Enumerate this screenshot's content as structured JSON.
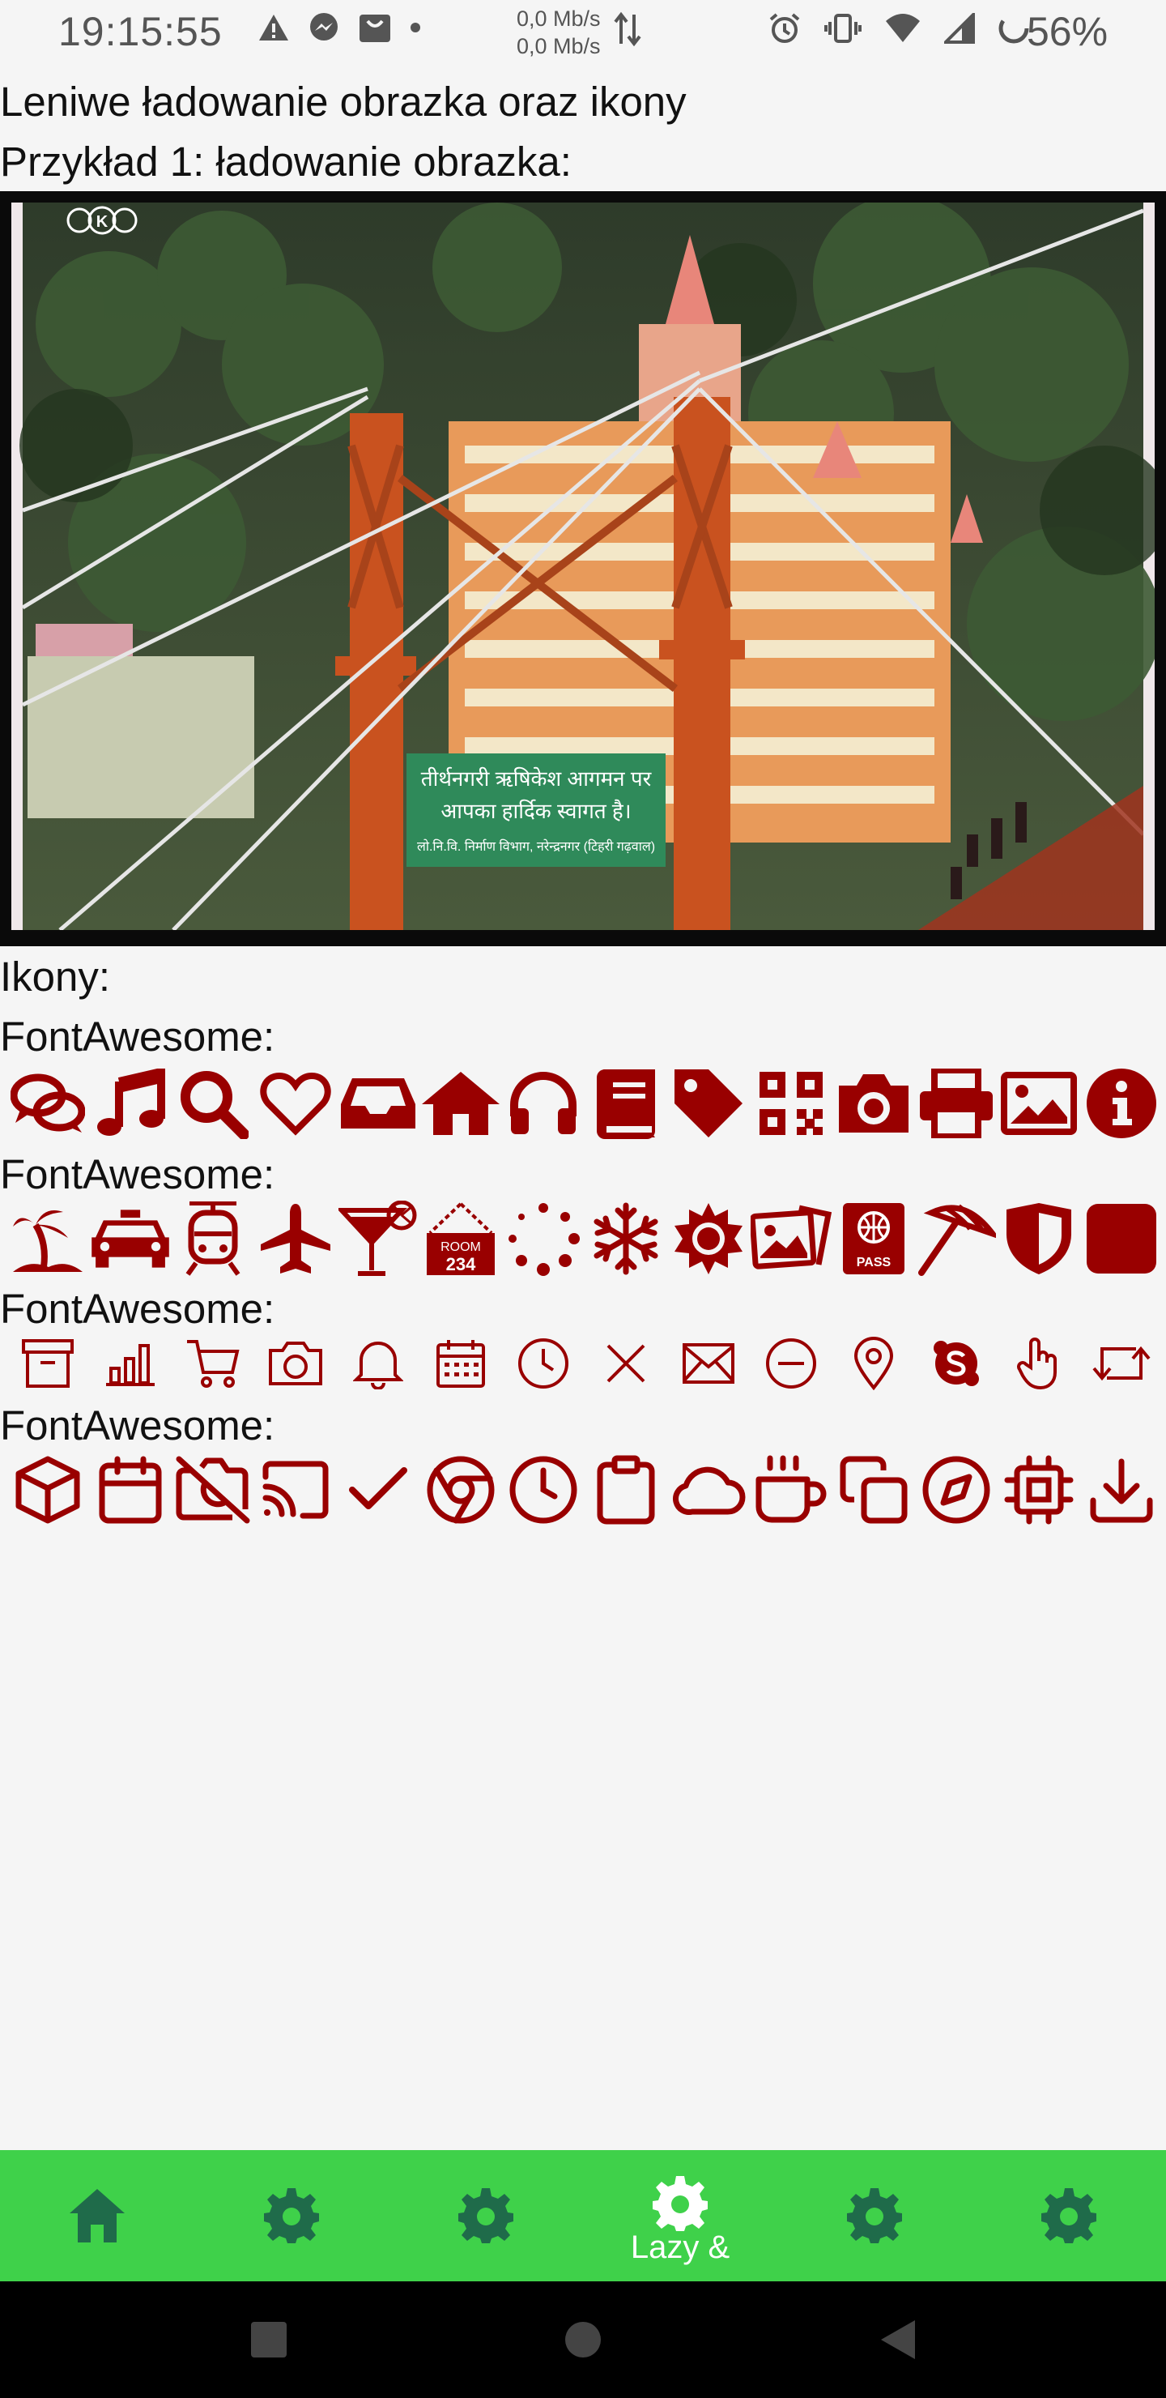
{
  "status_bar": {
    "time": "19:15:55",
    "net_up": "0,0 Mb/s",
    "net_down": "0,0 Mb/s",
    "battery": "56%",
    "icons_left": [
      "warning-icon",
      "messenger-icon",
      "shop-icon",
      "dot-icon"
    ],
    "icons_right": [
      "alarm-icon",
      "vibrate-icon",
      "wifi-icon",
      "signal-icon",
      "battery-icon"
    ]
  },
  "page": {
    "title": "Leniwe ładowanie obrazka oraz ikony",
    "example1": "Przykład 1: ładowanie obrazka:",
    "icons_heading": "Ikony:"
  },
  "image": {
    "watermark": "K",
    "sign_line1": "तीर्थनगरी ऋषिकेश आगमन पर",
    "sign_line2": "आपका हार्दिक स्वागत है।",
    "sign_line3": "लो.नि.वि. निर्माण विभाग, नरेन्द्रनगर (टिहरी गढ़वाल)"
  },
  "icon_sections": [
    {
      "label": "FontAwesome:",
      "icons": [
        "comments-icon",
        "music-icon",
        "search-icon",
        "heart-icon",
        "inbox-icon",
        "home-icon",
        "headphones-icon",
        "book-icon",
        "tag-icon",
        "qrcode-icon",
        "camera-icon",
        "print-icon",
        "image-icon",
        "info-circle-icon"
      ]
    },
    {
      "label": "FontAwesome:",
      "icons": [
        "island-icon",
        "taxi-icon",
        "monorail-icon",
        "plane-icon",
        "cocktail-icon",
        "room-sign-icon",
        "spinner-dots-icon",
        "snowflake-icon",
        "sun-icon",
        "images-icon",
        "passport-icon",
        "umbrella-beach-icon",
        "shield-icon",
        "square-icon"
      ],
      "room_text": "ROOM",
      "room_number": "234",
      "pass_text": "PASS"
    },
    {
      "label": "FontAwesome:",
      "icons": [
        "archive-icon",
        "bar-chart-icon",
        "cart-icon",
        "camera-outline-icon",
        "bell-icon",
        "calendar-icon",
        "clock-icon",
        "close-icon",
        "envelope-icon",
        "minus-circle-icon",
        "map-pin-icon",
        "skype-icon",
        "hand-pointer-icon",
        "retweet-icon"
      ]
    },
    {
      "label": "FontAwesome:",
      "icons": [
        "cube-icon",
        "calendar-outline-icon",
        "camera-off-icon",
        "cast-icon",
        "check-icon",
        "chrome-icon",
        "clock-outline-icon",
        "clipboard-icon",
        "cloud-icon",
        "coffee-icon",
        "copy-icon",
        "compass-icon",
        "cpu-icon",
        "download-icon"
      ]
    }
  ],
  "colors": {
    "icon": "#990000",
    "nav_bg": "#3fd14a",
    "nav_icon": "#1f6b4a",
    "nav_active": "#ffffff"
  },
  "bottom_nav": {
    "items": [
      {
        "icon": "home-icon",
        "label": ""
      },
      {
        "icon": "gear-icon",
        "label": ""
      },
      {
        "icon": "gear-icon",
        "label": ""
      },
      {
        "icon": "gear-icon",
        "label": "Lazy &"
      },
      {
        "icon": "gear-icon",
        "label": ""
      },
      {
        "icon": "gear-icon",
        "label": ""
      }
    ]
  },
  "system_nav": [
    "recents-button",
    "home-button",
    "back-button"
  ]
}
